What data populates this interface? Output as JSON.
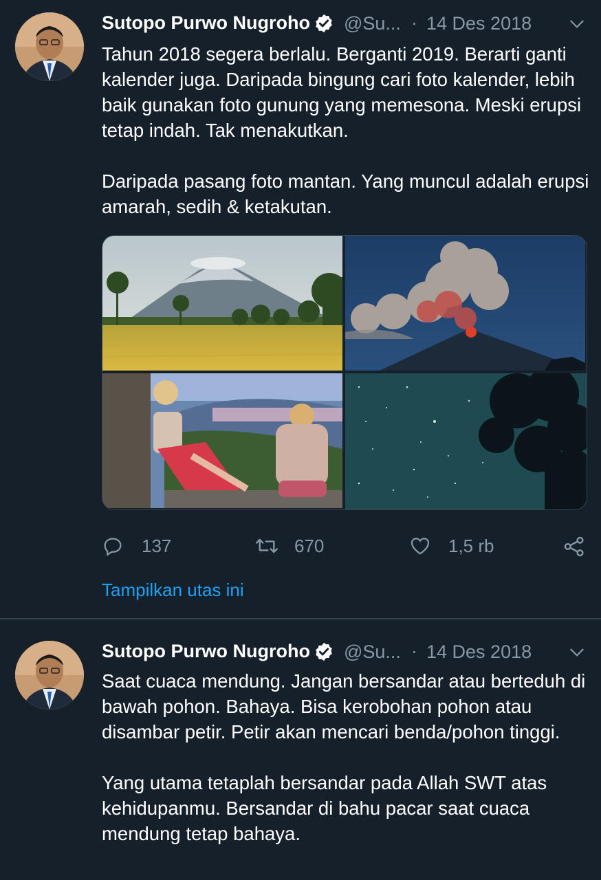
{
  "tweets": [
    {
      "author_name": "Sutopo Purwo Nugroho",
      "handle": "@Su...",
      "separator": "·",
      "date": "14 Des 2018",
      "paragraphs": [
        "Tahun 2018 segera berlalu. Berganti 2019. Berarti ganti kalender juga.  Daripada bingung cari foto kalender, lebih baik gunakan foto gunung yang memesona. Meski erupsi tetap indah. Tak menakutkan.",
        "Daripada pasang foto mantan. Yang muncul adalah erupsi amarah, sedih & ketakutan."
      ],
      "media": [
        "mountain-rice-field-photo",
        "volcano-eruption-photo",
        "women-sitting-mountain-view-photo",
        "starry-night-tree-photo"
      ],
      "actions": {
        "reply_count": "137",
        "retweet_count": "670",
        "like_count": "1,5 rb"
      },
      "show_thread": "Tampilkan utas ini"
    },
    {
      "author_name": "Sutopo Purwo Nugroho",
      "handle": "@Su...",
      "separator": "·",
      "date": "14 Des 2018",
      "paragraphs": [
        "Saat cuaca mendung. Jangan bersandar atau berteduh di bawah pohon. Bahaya. Bisa kerobohan pohon atau disambar petir. Petir akan mencari benda/pohon tinggi.",
        "Yang utama tetaplah bersandar pada Allah SWT atas kehidupanmu. Bersandar di bahu pacar saat cuaca mendung tetap bahaya."
      ]
    }
  ],
  "icons": {
    "verified": "verified-badge-icon",
    "more": "chevron-down-icon",
    "reply": "reply-icon",
    "retweet": "retweet-icon",
    "like": "heart-icon",
    "share": "share-icon"
  },
  "colors": {
    "background": "#15202b",
    "secondary_text": "#8899a6",
    "link": "#1da1f2",
    "divider": "#38444d"
  }
}
